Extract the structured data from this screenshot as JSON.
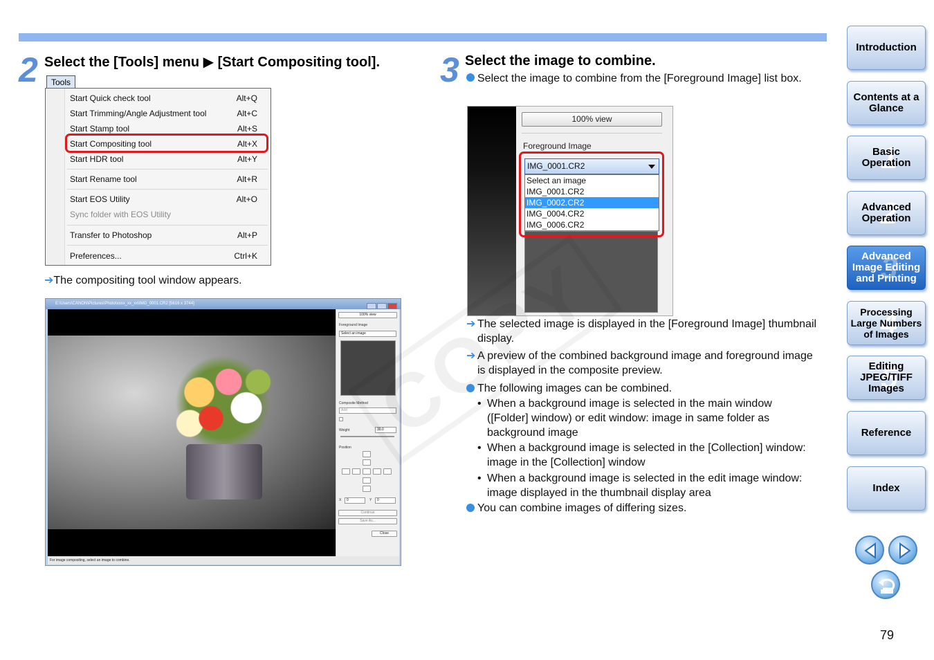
{
  "step2": {
    "number": "2",
    "title": "Select the [Tools] menu ▶ [Start Compositing tool].",
    "menu_tab": "Tools",
    "menu_items": [
      {
        "label": "Start Quick check tool",
        "shortcut": "Alt+Q"
      },
      {
        "label": "Start Trimming/Angle Adjustment tool",
        "shortcut": "Alt+C"
      },
      {
        "label": "Start Stamp tool",
        "shortcut": "Alt+S"
      },
      {
        "label": "Start Compositing tool",
        "shortcut": "Alt+X"
      },
      {
        "label": "Start HDR tool",
        "shortcut": "Alt+Y"
      },
      {
        "label": "Start Rename tool",
        "shortcut": "Alt+R"
      },
      {
        "label": "Start EOS Utility",
        "shortcut": "Alt+O"
      },
      {
        "label": "Sync folder with EOS Utility",
        "shortcut": ""
      },
      {
        "label": "Transfer to Photoshop",
        "shortcut": "Alt+P"
      },
      {
        "label": "Preferences...",
        "shortcut": "Ctrl+K"
      }
    ],
    "result_arrow": "➔",
    "result": "The compositing tool window appears."
  },
  "shot1": {
    "title": "E:\\Users\\CANON\\Pictures\\Photo\\xxxx_xx_xx\\IMG_0001.CR2 [5616 x 3744]",
    "view_btn": "100% view",
    "fg_label": "Foreground Image",
    "fg_select": "Select an image",
    "method_label": "Composite Method",
    "method_value": "Add",
    "weight_label": "Weight",
    "weight_value": "30.0",
    "position_label": "Position",
    "x_label": "X",
    "x_value": "0",
    "y_label": "Y",
    "y_value": "0",
    "continue_btn": "Continue",
    "save_btn": "Save As...",
    "close_btn": "Close",
    "status": "For image compositing, select an image to combine."
  },
  "step3": {
    "number": "3",
    "title": "Select the image to combine.",
    "intro": "Select the image to combine from the [Foreground Image] list box.",
    "result_arrow": "➔",
    "result1": "The selected image is displayed in the [Foreground Image] thumbnail display.",
    "result2": "A preview of the combined background image and foreground image is displayed in the composite preview.",
    "can_combine": "The following images can be combined.",
    "sub_bullet": "•",
    "sub1": "When a background image is selected in the main window ([Folder] window) or edit window: image in same folder as background image",
    "sub2": "When a background image is selected in the [Collection] window: image in the [Collection] window",
    "sub3": "When a background image is selected in the edit image window: image displayed in the thumbnail display area",
    "sizes": "You can combine images of differing sizes."
  },
  "shot2": {
    "view_btn": "100% view",
    "fg_label": "Foreground Image",
    "selected": "IMG_0001.CR2",
    "options": [
      "Select an image",
      "IMG_0001.CR2",
      "IMG_0002.CR2",
      "IMG_0004.CR2",
      "IMG_0006.CR2"
    ],
    "highlighted_index": 2
  },
  "watermark": "COPY",
  "sidebar": [
    {
      "label": "Introduction",
      "ghost": ""
    },
    {
      "label": "Contents at a Glance",
      "ghost": ""
    },
    {
      "label": "Basic Operation",
      "ghost": "1"
    },
    {
      "label": "Advanced Operation",
      "ghost": "2"
    },
    {
      "label": "Advanced Image Editing and Printing",
      "ghost": "3",
      "active": true
    },
    {
      "label": "Processing Large Numbers of Images",
      "ghost": "4"
    },
    {
      "label": "Editing JPEG/TIFF Images",
      "ghost": "5"
    },
    {
      "label": "Reference",
      "ghost": ""
    },
    {
      "label": "Index",
      "ghost": ""
    }
  ],
  "nav_icons": [
    "previous-page-icon",
    "next-page-icon",
    "return-icon"
  ],
  "page_number": "79",
  "colors": {
    "accent": "#3a8ee0",
    "highlight": "#e0191f",
    "bar": "#8fb6ee",
    "active_tab": "#2b74d0"
  }
}
